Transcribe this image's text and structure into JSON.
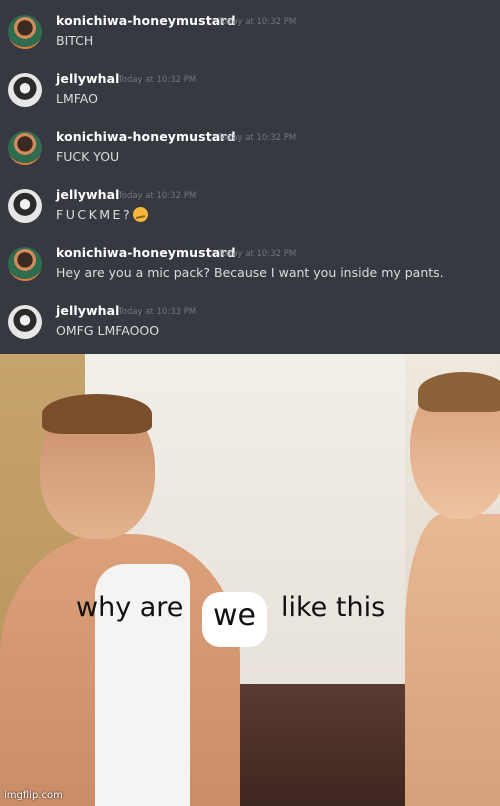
{
  "chat": {
    "messages": [
      {
        "username": "konichiwa-honeymustard",
        "timestamp": "Today at 10:32 PM",
        "text": "BITCH",
        "avatar": "honeymustard-avatar"
      },
      {
        "username": "jellywhal",
        "timestamp": "Today at 10:32 PM",
        "text": "LMFAO",
        "avatar": "jellywhal-avatar"
      },
      {
        "username": "konichiwa-honeymustard",
        "timestamp": "Today at 10:32 PM",
        "text": "FUCK YOU",
        "avatar": "honeymustard-avatar"
      },
      {
        "username": "jellywhal",
        "timestamp": "Today at 10:32 PM",
        "text": "FUCKME?",
        "emoji": "smirk-emoji",
        "avatar": "jellywhal-avatar"
      },
      {
        "username": "konichiwa-honeymustard",
        "timestamp": "Today at 10:32 PM",
        "text": "Hey are you a mic pack? Because I want you inside my pants.",
        "avatar": "honeymustard-avatar"
      },
      {
        "username": "jellywhal",
        "timestamp": "Today at 10:33 PM",
        "text": "OMFG LMFAOOO",
        "avatar": "jellywhal-avatar"
      }
    ],
    "colors": {
      "background": "#36393f",
      "username": "#ffffff",
      "timestamp": "#72767d",
      "text": "#dcddde"
    }
  },
  "meme": {
    "caption_left": "why are",
    "caption_insert": "we",
    "caption_right": "like this",
    "watermark": "imgflip.com"
  }
}
